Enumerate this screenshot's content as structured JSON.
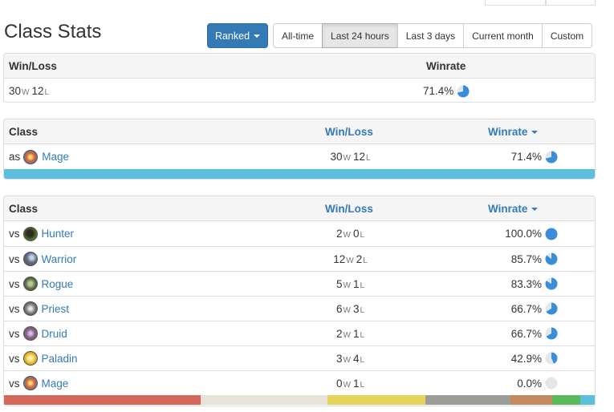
{
  "page_title": "Class Stats",
  "filters": {
    "mode_label": "Ranked",
    "ranges": [
      "All-time",
      "Last 24 hours",
      "Last 3 days",
      "Current month",
      "Custom"
    ],
    "active_range": "Last 24 hours"
  },
  "summary": {
    "headers": {
      "winloss": "Win/Loss",
      "winrate": "Winrate"
    },
    "wins": "30",
    "losses": "12",
    "w_unit": "W",
    "l_unit": "L",
    "winrate": "71.4%",
    "winrate_fraction": 0.714
  },
  "as_table": {
    "headers": {
      "class": "Class",
      "winloss": "Win/Loss",
      "winrate": "Winrate"
    },
    "rows": [
      {
        "prefix": "as",
        "class": "Mage",
        "wins": "30",
        "losses": "12",
        "winrate": "71.4%",
        "winrate_fraction": 0.714,
        "icon": "mage-icon"
      }
    ],
    "bar_segments": [
      {
        "color": "#5bc0de",
        "fraction": 1.0
      }
    ]
  },
  "vs_table": {
    "headers": {
      "class": "Class",
      "winloss": "Win/Loss",
      "winrate": "Winrate"
    },
    "rows": [
      {
        "prefix": "vs",
        "class": "Hunter",
        "wins": "2",
        "losses": "0",
        "winrate": "100.0%",
        "winrate_fraction": 1.0,
        "icon": "hunter-icon"
      },
      {
        "prefix": "vs",
        "class": "Warrior",
        "wins": "12",
        "losses": "2",
        "winrate": "85.7%",
        "winrate_fraction": 0.857,
        "icon": "warrior-icon"
      },
      {
        "prefix": "vs",
        "class": "Rogue",
        "wins": "5",
        "losses": "1",
        "winrate": "83.3%",
        "winrate_fraction": 0.833,
        "icon": "rogue-icon"
      },
      {
        "prefix": "vs",
        "class": "Priest",
        "wins": "6",
        "losses": "3",
        "winrate": "66.7%",
        "winrate_fraction": 0.667,
        "icon": "priest-icon"
      },
      {
        "prefix": "vs",
        "class": "Druid",
        "wins": "2",
        "losses": "1",
        "winrate": "66.7%",
        "winrate_fraction": 0.667,
        "icon": "druid-icon"
      },
      {
        "prefix": "vs",
        "class": "Paladin",
        "wins": "3",
        "losses": "4",
        "winrate": "42.9%",
        "winrate_fraction": 0.429,
        "icon": "paladin-icon"
      },
      {
        "prefix": "vs",
        "class": "Mage",
        "wins": "0",
        "losses": "1",
        "winrate": "0.0%",
        "winrate_fraction": 0.0,
        "icon": "mage-icon"
      }
    ],
    "bar_segments": [
      {
        "color": "#d5685a",
        "fraction": 0.333
      },
      {
        "color": "#e8e3d8",
        "fraction": 0.214
      },
      {
        "color": "#e8d45c",
        "fraction": 0.167
      },
      {
        "color": "#9d9d98",
        "fraction": 0.143
      },
      {
        "color": "#c48a5f",
        "fraction": 0.071
      },
      {
        "color": "#5cb85c",
        "fraction": 0.048
      },
      {
        "color": "#5bc0de",
        "fraction": 0.024
      }
    ]
  },
  "colors": {
    "primary": "#337ab7",
    "pie_fill": "#3a8ed8",
    "pie_empty": "#e6e6e6"
  }
}
